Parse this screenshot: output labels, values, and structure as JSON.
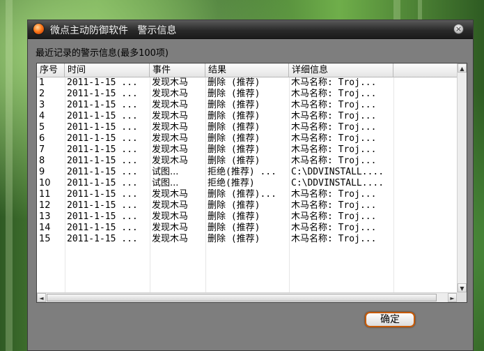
{
  "window": {
    "title": "微点主动防御软件   警示信息",
    "heading": "最近记录的警示信息(最多100项)",
    "close_glyph": "×"
  },
  "table": {
    "columns": [
      "序号",
      "时间",
      "事件",
      "结果",
      "详细信息"
    ],
    "rows": [
      [
        "1",
        "2011-1-15 ...",
        "发现木马",
        "删除 (推荐)",
        "木马名称: Troj..."
      ],
      [
        "2",
        "2011-1-15 ...",
        "发现木马",
        "删除 (推荐)",
        "木马名称: Troj..."
      ],
      [
        "3",
        "2011-1-15 ...",
        "发现木马",
        "删除 (推荐)",
        "木马名称: Troj..."
      ],
      [
        "4",
        "2011-1-15 ...",
        "发现木马",
        "删除 (推荐)",
        "木马名称: Troj..."
      ],
      [
        "5",
        "2011-1-15 ...",
        "发现木马",
        "删除 (推荐)",
        "木马名称: Troj..."
      ],
      [
        "6",
        "2011-1-15 ...",
        "发现木马",
        "删除 (推荐)",
        "木马名称: Troj..."
      ],
      [
        "7",
        "2011-1-15 ...",
        "发现木马",
        "删除 (推荐)",
        "木马名称: Troj..."
      ],
      [
        "8",
        "2011-1-15 ...",
        "发现木马",
        "删除 (推荐)",
        "木马名称: Troj..."
      ],
      [
        "9",
        "2011-1-15 ...",
        "试图...",
        "拒绝(推荐) ...",
        "C:\\DDVINSTALL...."
      ],
      [
        "10",
        "2011-1-15 ...",
        "试图...",
        "拒绝(推荐)",
        "C:\\DDVINSTALL...."
      ],
      [
        "11",
        "2011-1-15 ...",
        "发现木马",
        "删除 (推荐)...",
        "木马名称: Troj..."
      ],
      [
        "12",
        "2011-1-15 ...",
        "发现木马",
        "删除 (推荐)",
        "木马名称: Troj..."
      ],
      [
        "13",
        "2011-1-15 ...",
        "发现木马",
        "删除 (推荐)",
        "木马名称: Troj..."
      ],
      [
        "14",
        "2011-1-15 ...",
        "发现木马",
        "删除 (推荐)",
        "木马名称: Troj..."
      ],
      [
        "15",
        "2011-1-15 ...",
        "发现木马",
        "删除 (推荐)",
        "木马名称: Troj..."
      ]
    ]
  },
  "scroll_arrows": {
    "up": "▲",
    "down": "▼",
    "left": "◄",
    "right": "►"
  },
  "buttons": {
    "ok": "确定"
  },
  "colors": {
    "button_border": "#c65a08",
    "titlebar": "#2a2a2a",
    "window_bg": "#7e7e7e"
  }
}
